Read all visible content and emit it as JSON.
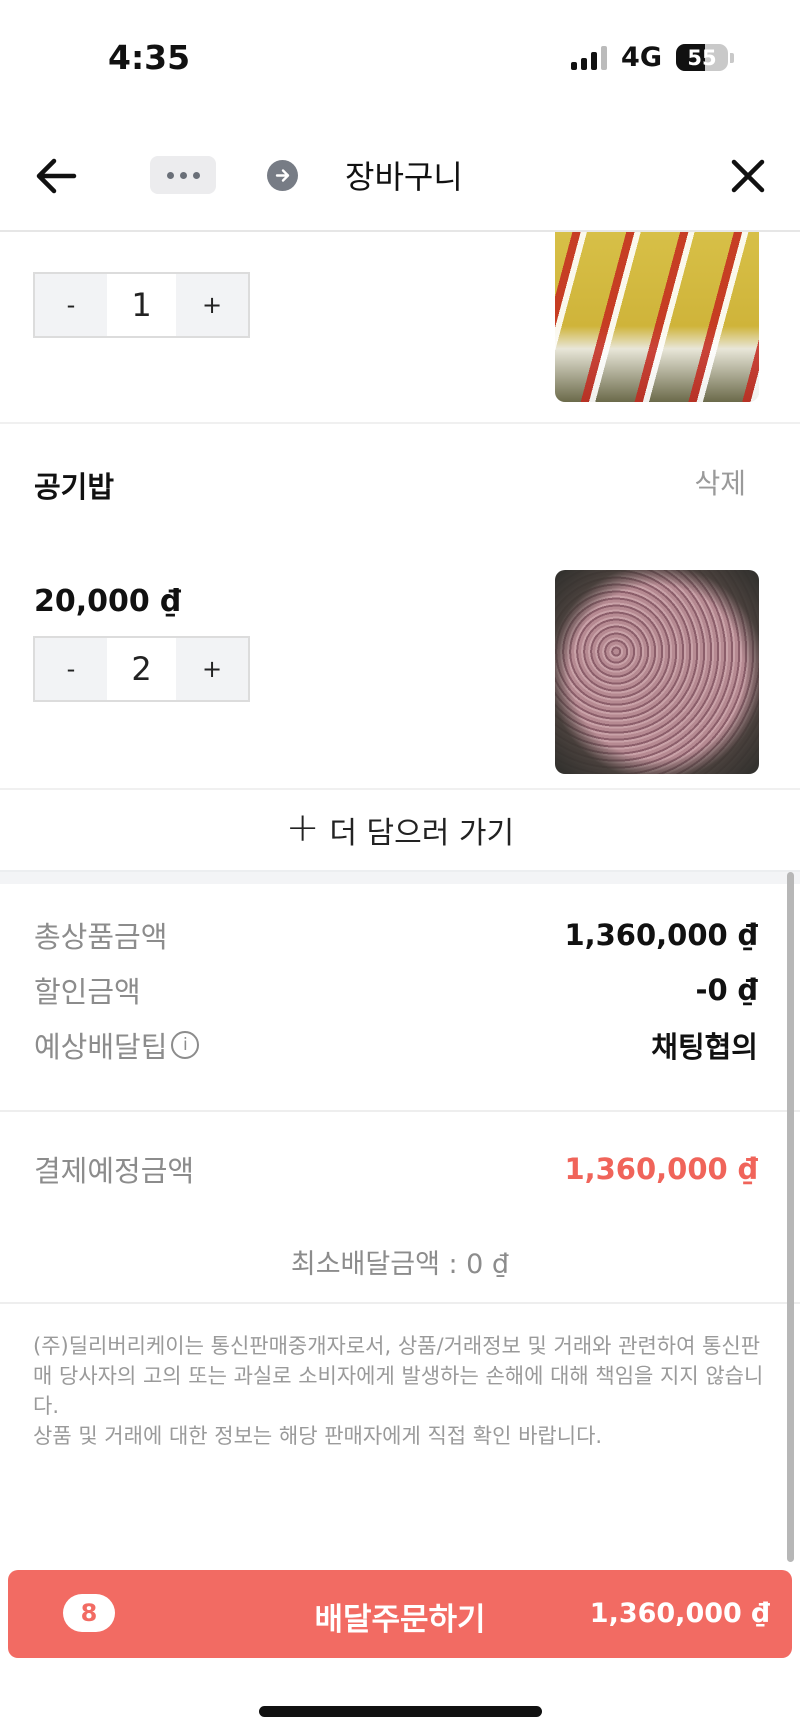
{
  "status_bar": {
    "time": "4:35",
    "network": "4G",
    "battery_level": "55",
    "battery_fraction": 0.55
  },
  "nav": {
    "title": "장바구니"
  },
  "cart": {
    "items": [
      {
        "quantity": "1",
        "minus_label": "-",
        "plus_label": "+"
      },
      {
        "name": "공기밥",
        "delete_label": "삭제",
        "price": "20,000 ₫",
        "quantity": "2",
        "minus_label": "-",
        "plus_label": "+"
      }
    ],
    "add_more_label": "더 담으러 가기"
  },
  "summary": {
    "total_products_label": "총상품금액",
    "total_products_value": "1,360,000 ₫",
    "discount_label": "할인금액",
    "discount_value": "-0 ₫",
    "delivery_tip_label": "예상배달팁",
    "delivery_tip_value": "채팅협의",
    "payment_label": "결제예정금액",
    "payment_value": "1,360,000 ₫",
    "min_delivery": "최소배달금액 : 0 ₫"
  },
  "notice": {
    "line1": "(주)딜리버리케이는 통신판매중개자로서, 상품/거래정보 및 거래와 관련하여 통신판매 당사자의 고의 또는 과실로 소비자에게 발생하는 손해에 대해 책임을 지지 않습니다.",
    "line2": "상품 및 거래에 대한 정보는 해당 판매자에게 직접 확인 바랍니다."
  },
  "order_bar": {
    "count": "8",
    "label": "배달주문하기",
    "total": "1,360,000 ₫"
  },
  "colors": {
    "accent": "#f26b63",
    "payment_text": "#f0645a"
  }
}
